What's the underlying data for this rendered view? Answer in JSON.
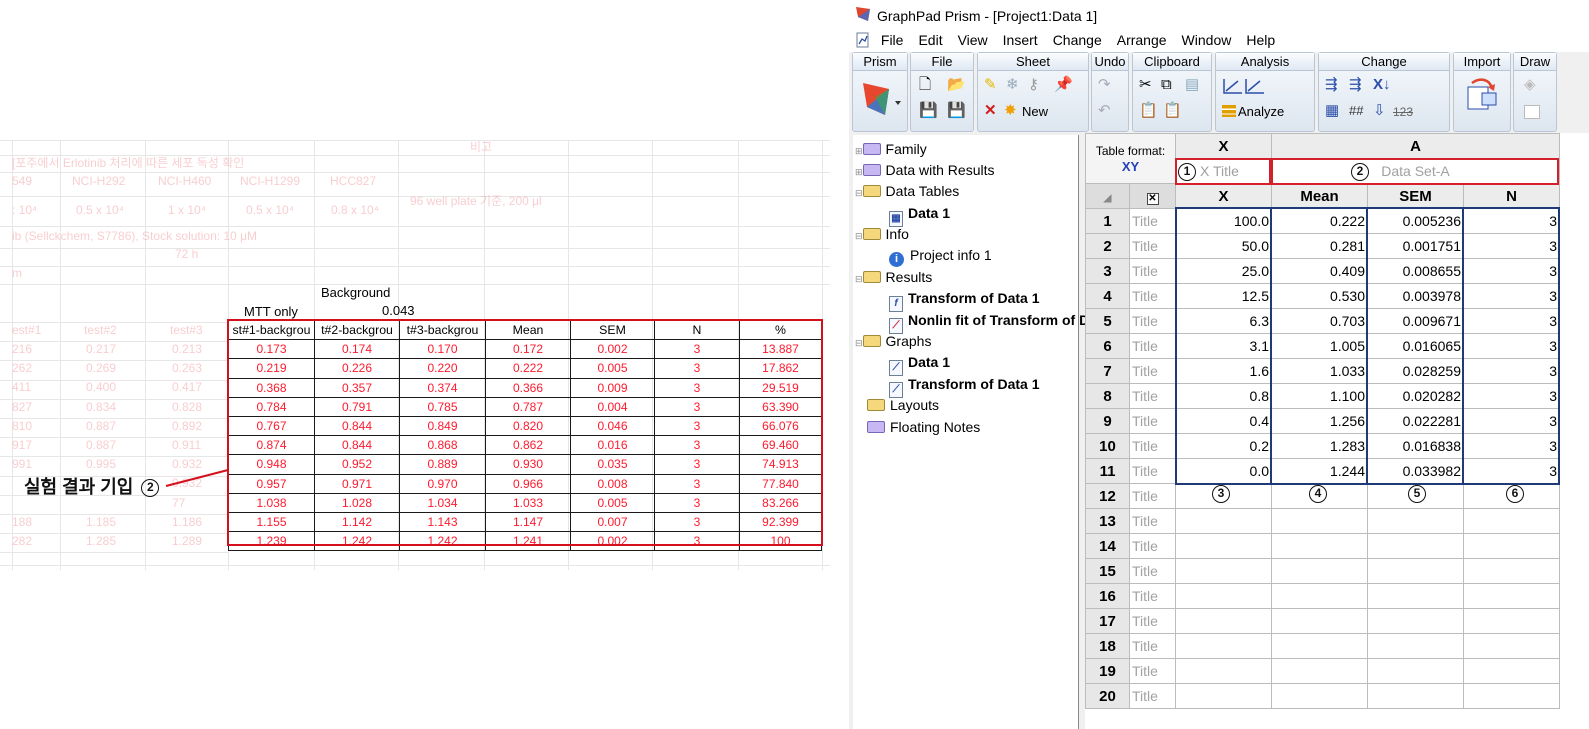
{
  "left": {
    "faint": {
      "remark": "비고",
      "experiment": "[포주에서 Erlotinib 처리에 따른 세포 독성 확인",
      "lines": [
        "549",
        "NCI-H292",
        "NCI-H460",
        "NCI-H1299",
        "HCC827"
      ],
      "density_prefix": ": 10⁴",
      "densities": [
        "0.5 x 10⁴",
        "1 x 10⁴",
        "0.5 x 10⁴",
        "0.8 x 10⁴"
      ],
      "well_note": "96 well plate 기준, 200 μl",
      "drug": "ib (Sellckchem, S7786), Stock solution: 10 μM",
      "time": "72 h",
      "m": "m",
      "test_headers": [
        "est#1",
        "test#2",
        "test#3"
      ],
      "test_values": [
        [
          "216",
          "0.217",
          "0.213"
        ],
        [
          "262",
          "0.269",
          "0.263"
        ],
        [
          "411",
          "0.400",
          "0.417"
        ],
        [
          "827",
          "0.834",
          "0.828"
        ],
        [
          "810",
          "0.887",
          "0.892"
        ],
        [
          "917",
          "0.887",
          "0.911"
        ],
        [
          "991",
          "0.995",
          "0.932"
        ],
        [
          "",
          "",
          "0.932"
        ],
        [
          "",
          "",
          "77"
        ],
        [
          "188",
          "1.185",
          "1.186"
        ],
        [
          "282",
          "1.285",
          "1.289"
        ]
      ]
    },
    "background_label": "Background",
    "mtt_label": "MTT only",
    "mtt_value": "0.043",
    "headers": [
      "st#1-backgrou",
      "t#2-backgrou",
      "t#3-backgrou",
      "Mean",
      "SEM",
      "N",
      "%"
    ],
    "rows": [
      [
        "0.173",
        "0.174",
        "0.170",
        "0.172",
        "0.002",
        "3",
        "13.887"
      ],
      [
        "0.219",
        "0.226",
        "0.220",
        "0.222",
        "0.005",
        "3",
        "17.862"
      ],
      [
        "0.368",
        "0.357",
        "0.374",
        "0.366",
        "0.009",
        "3",
        "29.519"
      ],
      [
        "0.784",
        "0.791",
        "0.785",
        "0.787",
        "0.004",
        "3",
        "63.390"
      ],
      [
        "0.767",
        "0.844",
        "0.849",
        "0.820",
        "0.046",
        "3",
        "66.076"
      ],
      [
        "0.874",
        "0.844",
        "0.868",
        "0.862",
        "0.016",
        "3",
        "69.460"
      ],
      [
        "0.948",
        "0.952",
        "0.889",
        "0.930",
        "0.035",
        "3",
        "74.913"
      ],
      [
        "0.957",
        "0.971",
        "0.970",
        "0.966",
        "0.008",
        "3",
        "77.840"
      ],
      [
        "1.038",
        "1.028",
        "1.034",
        "1.033",
        "0.005",
        "3",
        "83.266"
      ],
      [
        "1.155",
        "1.142",
        "1.143",
        "1.147",
        "0.007",
        "3",
        "92.399"
      ],
      [
        "1.239",
        "1.242",
        "1.242",
        "1.241",
        "0.002",
        "3",
        "100"
      ]
    ],
    "annotation": "실험 결과 기입",
    "annotation_num": "2"
  },
  "prism": {
    "title": "GraphPad Prism - [Project1:Data 1]",
    "menu": [
      "File",
      "Edit",
      "View",
      "Insert",
      "Change",
      "Arrange",
      "Window",
      "Help"
    ],
    "groups": [
      "Prism",
      "File",
      "Sheet",
      "Undo",
      "Clipboard",
      "Analysis",
      "Change",
      "Import",
      "Draw"
    ],
    "new_label": "New",
    "analyze_label": "Analyze",
    "tree": {
      "family": "Family",
      "data_with_results": "Data with Results",
      "data_tables": "Data Tables",
      "data1": "Data 1",
      "info": "Info",
      "project_info": "Project info 1",
      "results": "Results",
      "transform": "Transform of Data 1",
      "nonlin": "Nonlin fit of Transform of Data 1",
      "graphs": "Graphs",
      "graph_data1": "Data 1",
      "graph_transform": "Transform of Data 1",
      "layouts": "Layouts",
      "floating_notes": "Floating Notes"
    },
    "grid": {
      "table_format_label": "Table format:",
      "table_format_value": "XY",
      "col_x": "X",
      "col_a": "A",
      "x_title": "X Title",
      "dataset_title": "Data Set-A",
      "sub_headers": [
        "X",
        "Mean",
        "SEM",
        "N"
      ],
      "row_title": "Title",
      "rows": [
        [
          "100.0",
          "0.222",
          "0.005236",
          "3"
        ],
        [
          "50.0",
          "0.281",
          "0.001751",
          "3"
        ],
        [
          "25.0",
          "0.409",
          "0.008655",
          "3"
        ],
        [
          "12.5",
          "0.530",
          "0.003978",
          "3"
        ],
        [
          "6.3",
          "0.703",
          "0.009671",
          "3"
        ],
        [
          "3.1",
          "1.005",
          "0.016065",
          "3"
        ],
        [
          "1.6",
          "1.033",
          "0.028259",
          "3"
        ],
        [
          "0.8",
          "1.100",
          "0.020282",
          "3"
        ],
        [
          "0.4",
          "1.256",
          "0.022281",
          "3"
        ],
        [
          "0.2",
          "1.283",
          "0.016838",
          "3"
        ],
        [
          "0.0",
          "1.244",
          "0.033982",
          "3"
        ]
      ],
      "empty_row_numbers": [
        "12",
        "13",
        "14",
        "15",
        "16",
        "17",
        "18",
        "19",
        "20"
      ],
      "markers": [
        "1",
        "2",
        "3",
        "4",
        "5",
        "6"
      ]
    }
  }
}
